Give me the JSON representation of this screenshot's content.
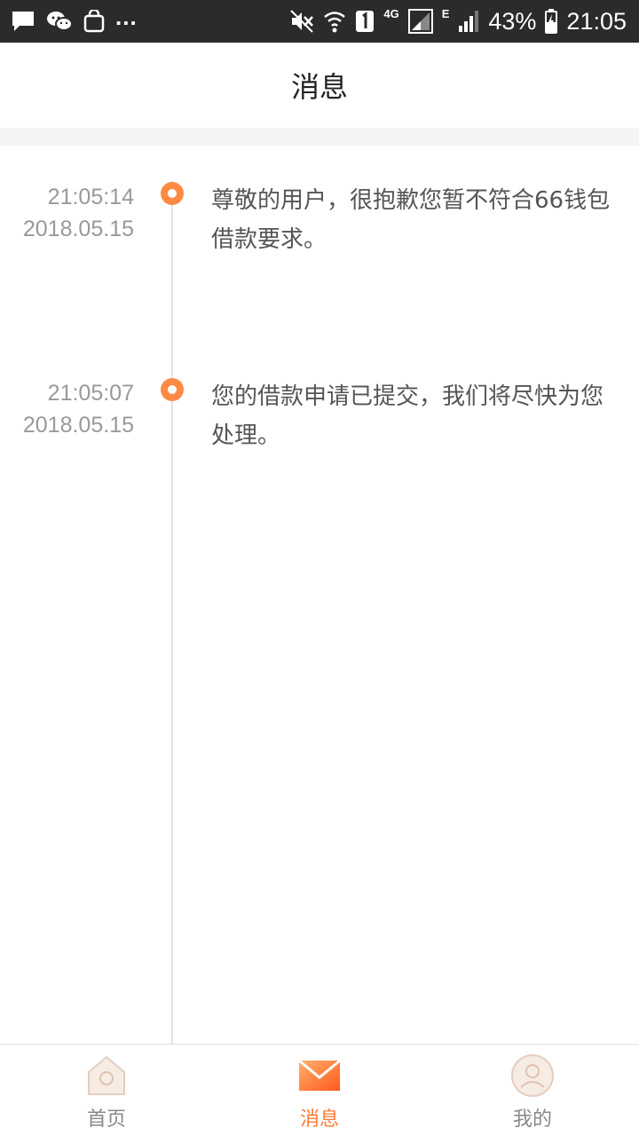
{
  "status_bar": {
    "dots": "...",
    "network": "4G",
    "data_type": "E",
    "battery": "43%",
    "time": "21:05"
  },
  "header": {
    "title": "消息"
  },
  "messages": [
    {
      "time": "21:05:14",
      "date": "2018.05.15",
      "text": "尊敬的用户，很抱歉您暂不符合66钱包借款要求。"
    },
    {
      "time": "21:05:07",
      "date": "2018.05.15",
      "text": "您的借款申请已提交，我们将尽快为您处理。"
    }
  ],
  "nav": [
    {
      "label": "首页",
      "icon": "home-icon"
    },
    {
      "label": "消息",
      "icon": "mail-icon",
      "active": true
    },
    {
      "label": "我的",
      "icon": "profile-icon"
    }
  ],
  "colors": {
    "accent": "#ff7a35",
    "status_bar": "#2b2b2b"
  }
}
